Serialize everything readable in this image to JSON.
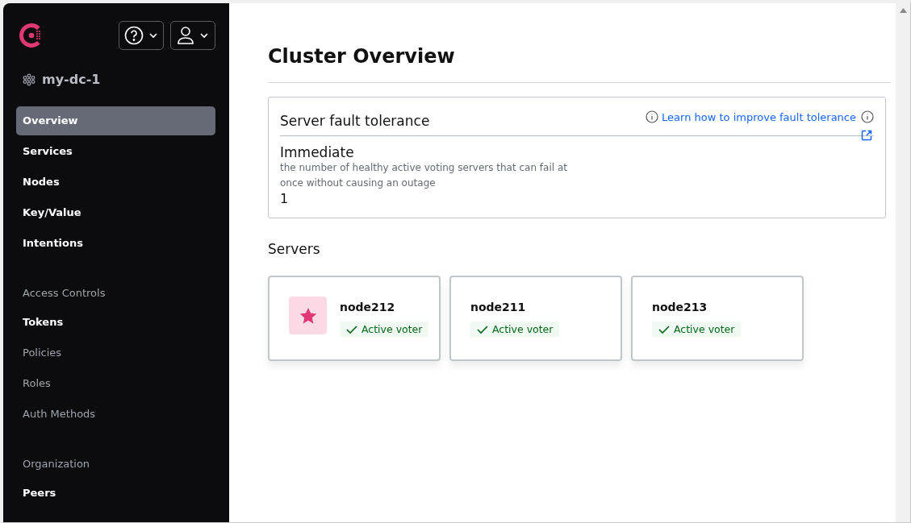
{
  "sidebar": {
    "datacenter": "my-dc-1",
    "items": [
      {
        "kind": "link",
        "label": "Overview",
        "selected": true,
        "dimmed": false
      },
      {
        "kind": "link",
        "label": "Services",
        "selected": false,
        "dimmed": false
      },
      {
        "kind": "link",
        "label": "Nodes",
        "selected": false,
        "dimmed": false
      },
      {
        "kind": "link",
        "label": "Key/Value",
        "selected": false,
        "dimmed": false
      },
      {
        "kind": "link",
        "label": "Intentions",
        "selected": false,
        "dimmed": false
      },
      {
        "kind": "heading",
        "label": "Access Controls"
      },
      {
        "kind": "link",
        "label": "Tokens",
        "selected": false,
        "dimmed": false
      },
      {
        "kind": "link",
        "label": "Policies",
        "selected": false,
        "dimmed": true
      },
      {
        "kind": "link",
        "label": "Roles",
        "selected": false,
        "dimmed": true
      },
      {
        "kind": "link",
        "label": "Auth Methods",
        "selected": false,
        "dimmed": true
      },
      {
        "kind": "heading",
        "label": "Organization"
      },
      {
        "kind": "link",
        "label": "Peers",
        "selected": false,
        "dimmed": false
      }
    ]
  },
  "page": {
    "title": "Cluster Overview"
  },
  "fault_tolerance": {
    "title": "Server fault tolerance",
    "link": "Learn how to improve fault tolerance",
    "label": "Immediate",
    "description": "the number of healthy active voting servers that can fail at once without causing an outage",
    "value": "1"
  },
  "servers": {
    "title": "Servers",
    "items": [
      {
        "name": "node212",
        "leader": true,
        "status": "Active voter"
      },
      {
        "name": "node211",
        "leader": false,
        "status": "Active voter"
      },
      {
        "name": "node213",
        "leader": false,
        "status": "Active voter"
      }
    ]
  }
}
